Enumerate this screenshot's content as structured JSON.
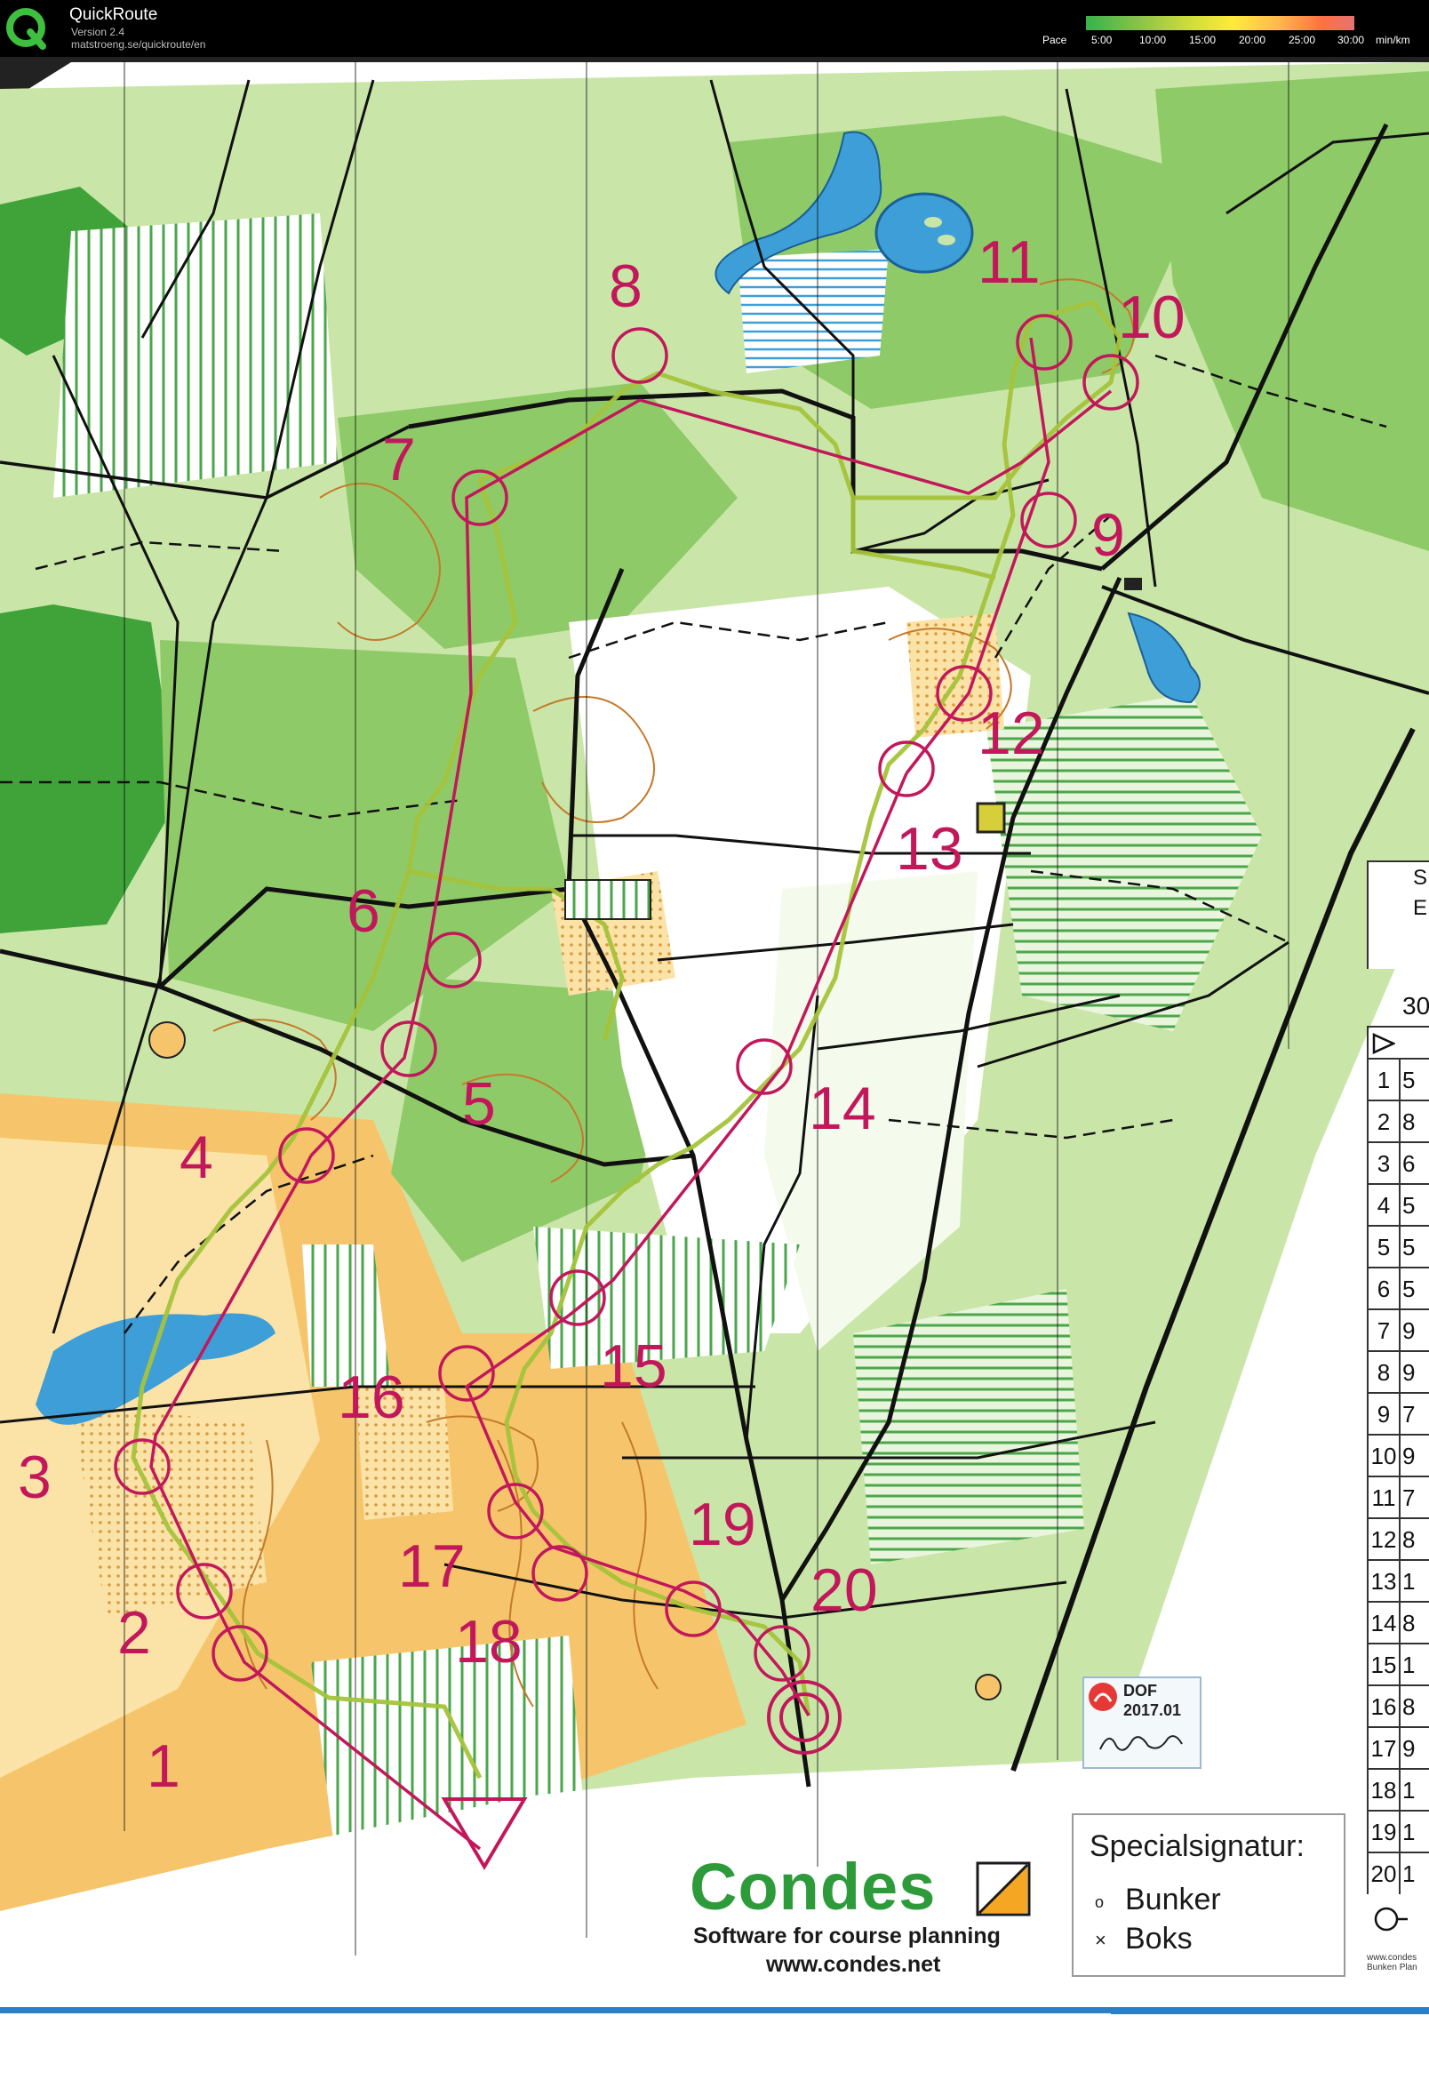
{
  "app": {
    "name": "QuickRoute",
    "version": "Version 2.4",
    "url": "matstroeng.se/quickroute/en"
  },
  "pace_legend": {
    "title": "Pace",
    "ticks": [
      "5:00",
      "10:00",
      "15:00",
      "20:00",
      "25:00",
      "30:00"
    ],
    "unit": "min/km",
    "colors": [
      "#37b24d",
      "#8bc34a",
      "#cddc39",
      "#ffeb3b",
      "#ffb74d",
      "#ff7043",
      "#e53935"
    ]
  },
  "map": {
    "colors": {
      "open_land": "#f6c56b",
      "rough_open": "#fbe3a8",
      "forest_white": "#ffffff",
      "green_light": "#c9e6a8",
      "green_medium": "#8fca68",
      "green_dark": "#3fa33a",
      "contour": "#c47a2a",
      "water": "#3e9fd8",
      "course": "#c2185b",
      "track_route": "#a5c33b",
      "path": "#111111",
      "blue_border": "#2a7fc9"
    },
    "start_symbol": "triangle",
    "controls": [
      {
        "number": "1"
      },
      {
        "number": "2"
      },
      {
        "number": "3"
      },
      {
        "number": "4"
      },
      {
        "number": "5"
      },
      {
        "number": "6"
      },
      {
        "number": "7"
      },
      {
        "number": "8"
      },
      {
        "number": "9"
      },
      {
        "number": "10"
      },
      {
        "number": "11"
      },
      {
        "number": "12"
      },
      {
        "number": "13"
      },
      {
        "number": "14"
      },
      {
        "number": "15"
      },
      {
        "number": "16"
      },
      {
        "number": "17"
      },
      {
        "number": "18"
      },
      {
        "number": "19"
      },
      {
        "number": "20"
      }
    ]
  },
  "course_table": {
    "header_partial_1": "S",
    "header_partial_2": "E",
    "length_partial": "30",
    "rows": [
      {
        "num": "1",
        "code": "5"
      },
      {
        "num": "2",
        "code": "8"
      },
      {
        "num": "3",
        "code": "6"
      },
      {
        "num": "4",
        "code": "5"
      },
      {
        "num": "5",
        "code": "5"
      },
      {
        "num": "6",
        "code": "5"
      },
      {
        "num": "7",
        "code": "9"
      },
      {
        "num": "8",
        "code": "9"
      },
      {
        "num": "9",
        "code": "7"
      },
      {
        "num": "10",
        "code": "9"
      },
      {
        "num": "11",
        "code": "7"
      },
      {
        "num": "12",
        "code": "8"
      },
      {
        "num": "13",
        "code": "1"
      },
      {
        "num": "14",
        "code": "8"
      },
      {
        "num": "15",
        "code": "1"
      },
      {
        "num": "16",
        "code": "8"
      },
      {
        "num": "17",
        "code": "9"
      },
      {
        "num": "18",
        "code": "1"
      },
      {
        "num": "19",
        "code": "1"
      },
      {
        "num": "20",
        "code": "1"
      }
    ],
    "footer_partial_1": "www.condes",
    "footer_partial_2": "Bunken Plan"
  },
  "condes": {
    "logo_text": "Condes",
    "tagline": "Software for course planning",
    "url": "www.condes.net"
  },
  "special": {
    "title": "Specialsignatur:",
    "bunker_label": "Bunker",
    "boks_label": "Boks",
    "bunker_symbol": "o",
    "boks_symbol": "×"
  },
  "dof": {
    "text": "DOF",
    "version": "2017.01"
  }
}
